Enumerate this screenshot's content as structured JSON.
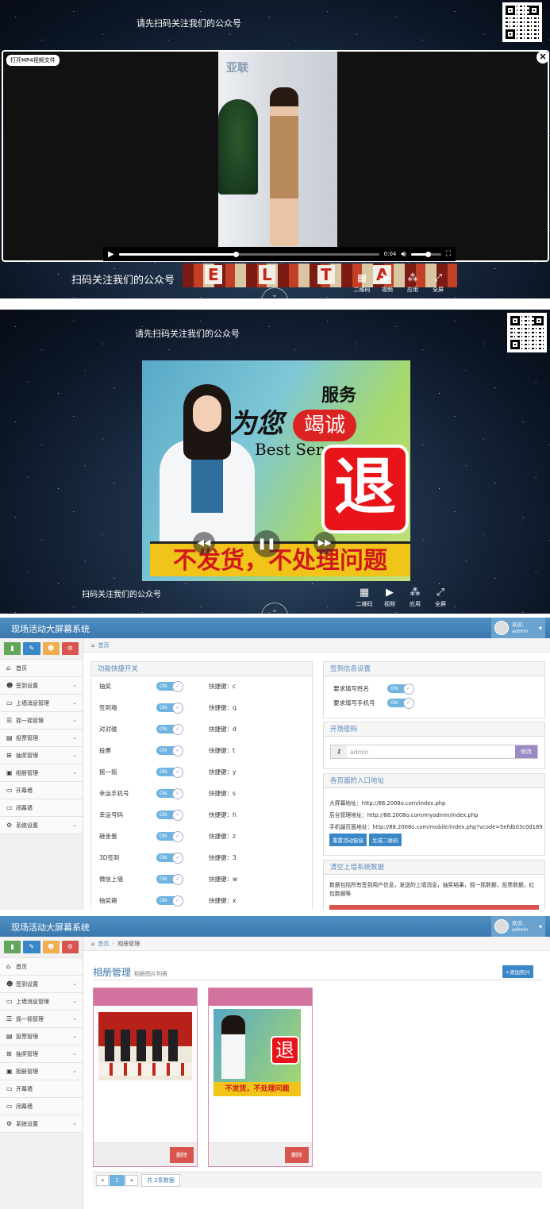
{
  "screen1": {
    "banner_top": "请先扫码关注我们的公众号",
    "banner_bottom": "扫码关注我们的公众号",
    "open_file_label": "打开MP4视频文件",
    "close_icon": "close-icon",
    "video_time": "0:04",
    "video_progress": 0.45,
    "volume_level": 0.55,
    "tools": [
      {
        "label": "二维码",
        "icon": "qrcode-icon"
      },
      {
        "label": "视频",
        "icon": "video-icon"
      },
      {
        "label": "应用",
        "icon": "apps-icon"
      },
      {
        "label": "全屏",
        "icon": "fullscreen-icon"
      }
    ],
    "strip_letters": [
      "E",
      "L",
      "T",
      "A"
    ]
  },
  "screen2": {
    "banner_top": "请先扫码关注我们的公众号",
    "banner_bottom": "扫码关注我们的公众号",
    "promo": {
      "service": "服务",
      "for_you": "为您",
      "sincere": "竭诚",
      "best": "Best Ser",
      "refund": "退",
      "bottom_text": "不发货，不处理问题"
    },
    "tools": [
      {
        "label": "二维码",
        "icon": "qrcode-icon"
      },
      {
        "label": "视频",
        "icon": "video-icon"
      },
      {
        "label": "应用",
        "icon": "apps-icon"
      },
      {
        "label": "全屏",
        "icon": "fullscreen-icon"
      }
    ]
  },
  "admin": {
    "app_title": "现场活动大屏幕系统",
    "user_greeting": "欢迎,",
    "user_name": "admin",
    "quick_colors": [
      "#62a65a",
      "#3a87c8",
      "#f0ad4e",
      "#d9534f"
    ],
    "nav": [
      {
        "label": "首页",
        "icon": "home-icon",
        "has_arrow": false
      },
      {
        "label": "签到设置",
        "icon": "users-icon",
        "has_arrow": true
      },
      {
        "label": "上墙消息管理",
        "icon": "monitor-icon",
        "has_arrow": true
      },
      {
        "label": "摇一摇管理",
        "icon": "list-icon",
        "has_arrow": true
      },
      {
        "label": "投票管理",
        "icon": "vote-icon",
        "has_arrow": true
      },
      {
        "label": "抽奖管理",
        "icon": "gift-icon",
        "has_arrow": true
      },
      {
        "label": "相册管理",
        "icon": "image-icon",
        "has_arrow": true
      },
      {
        "label": "开幕墙",
        "icon": "screen-icon",
        "has_arrow": false
      },
      {
        "label": "闭幕墙",
        "icon": "screen-icon",
        "has_arrow": false
      },
      {
        "label": "系统设置",
        "icon": "gear-icon",
        "has_arrow": true
      }
    ]
  },
  "dashboard": {
    "breadcrumb_home": "首页",
    "feature_panel_title": "功能快捷开关",
    "on_label": "ON",
    "shortcut_prefix": "快捷键：",
    "features": [
      {
        "name": "抽奖",
        "key": "c"
      },
      {
        "name": "签到墙",
        "key": "q"
      },
      {
        "name": "对对碰",
        "key": "d"
      },
      {
        "name": "投票",
        "key": "t"
      },
      {
        "name": "摇一摇",
        "key": "y"
      },
      {
        "name": "幸运手机号",
        "key": "s"
      },
      {
        "name": "幸运号码",
        "key": "h"
      },
      {
        "name": "砸金蛋",
        "key": "z"
      },
      {
        "name": "3D签到",
        "key": "3"
      },
      {
        "name": "微信上墙",
        "key": "w"
      },
      {
        "name": "抽奖箱",
        "key": "x"
      }
    ],
    "signin_panel_title": "签到信息设置",
    "signin_options": [
      "要求填写姓名",
      "要求填写手机号"
    ],
    "password_panel_title": "开场密码",
    "password_value": "admin",
    "password_button": "修改",
    "entry_panel_title": "各页面的入口地址",
    "entries": [
      "大屏幕地址：http://88.2008o.com/index.php",
      "后台管理地址：http://88.2008o.com/myadmin/index.php",
      "手机端页面地址：http://88.2008o.com/mobile/index.php?vcode=5efdb03c0d189"
    ],
    "reset_button": "重置活动链接",
    "qr_button": "生成二维码",
    "clear_panel_title": "清空上墙系统数据",
    "clear_desc": "数据包括所有签到用户信息，发送的上墙消息，抽奖结果，摇一摇数据，投票数据，红包数据等"
  },
  "album": {
    "breadcrumb_home": "首页",
    "breadcrumb_current": "相册管理",
    "title": "相册管理",
    "subtitle": "相册图片列表",
    "add_button": "+添加照片",
    "delete_label": "删除",
    "pagination": {
      "prev": "«",
      "current": "1",
      "next": "»",
      "total": "共 2条数据"
    }
  }
}
